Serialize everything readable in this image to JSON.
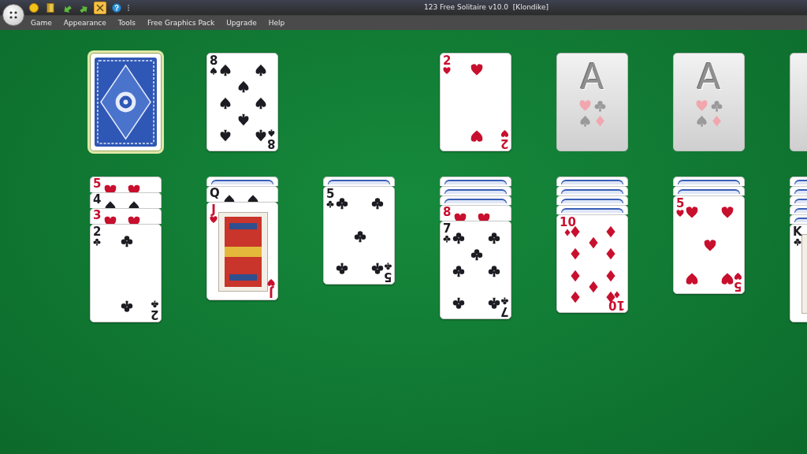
{
  "window": {
    "title": "123 Free Solitaire v10.0  [Klondike]"
  },
  "toolbar": [
    {
      "kind": "coin",
      "selected": false
    },
    {
      "kind": "book",
      "selected": false
    },
    {
      "kind": "undo",
      "selected": false
    },
    {
      "kind": "redo",
      "selected": false
    },
    {
      "kind": "tools",
      "selected": true
    },
    {
      "kind": "help",
      "selected": false
    }
  ],
  "menu": [
    "Game",
    "Appearance",
    "Tools",
    "Free Graphics Pack",
    "Upgrade",
    "Help"
  ],
  "top_row": [
    {
      "kind": "stock",
      "selected": true
    },
    {
      "kind": "spades",
      "rank": "8",
      "corner_rank": "8"
    },
    {
      "kind": "gap"
    },
    {
      "kind": "hearts",
      "rank": "2",
      "corner_rank": "2"
    },
    {
      "kind": "empty",
      "label": "A"
    },
    {
      "kind": "empty",
      "label": "A"
    },
    {
      "kind": "empty"
    }
  ],
  "tableau": [
    {
      "cards": [
        {
          "kind": "hearts",
          "rank": "5"
        },
        {
          "kind": "spades",
          "rank": "4"
        },
        {
          "kind": "hearts",
          "rank": "3"
        },
        {
          "kind": "clubs",
          "rank": "2",
          "corner_rank": "2"
        }
      ]
    },
    {
      "cards": [
        {
          "kind": "down"
        },
        {
          "kind": "spades",
          "rank": "Q"
        },
        {
          "kind": "hearts",
          "rank": "J",
          "corner_rank": "J"
        }
      ]
    },
    {
      "cards": [
        {
          "kind": "down"
        },
        {
          "kind": "clubs",
          "rank": "5",
          "corner_rank": "5"
        }
      ]
    },
    {
      "cards": [
        {
          "kind": "down"
        },
        {
          "kind": "down"
        },
        {
          "kind": "down"
        },
        {
          "kind": "hearts",
          "rank": "8"
        },
        {
          "kind": "clubs",
          "rank": "7",
          "corner_rank": "7"
        }
      ]
    },
    {
      "cards": [
        {
          "kind": "down"
        },
        {
          "kind": "down"
        },
        {
          "kind": "down"
        },
        {
          "kind": "down"
        },
        {
          "kind": "diamonds",
          "rank": "10",
          "corner_rank": "10"
        }
      ]
    },
    {
      "cards": [
        {
          "kind": "down"
        },
        {
          "kind": "down"
        },
        {
          "kind": "hearts",
          "rank": "5",
          "corner_rank": "5"
        }
      ]
    },
    {
      "cards": [
        {
          "kind": "down"
        },
        {
          "kind": "down"
        },
        {
          "kind": "down"
        },
        {
          "kind": "down"
        },
        {
          "kind": "down"
        },
        {
          "kind": "clubs",
          "rank": "K"
        }
      ]
    }
  ]
}
